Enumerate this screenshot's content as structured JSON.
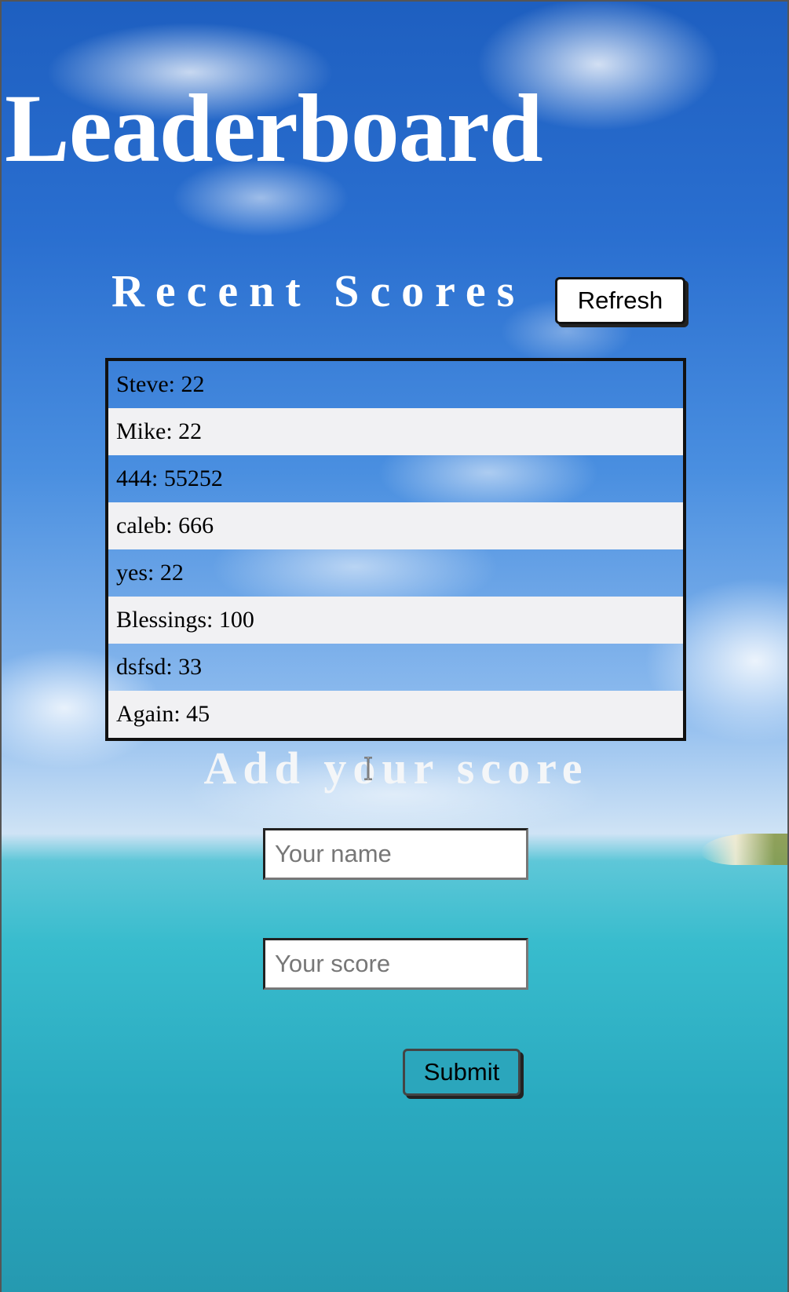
{
  "page": {
    "title": "Leaderboard",
    "background": "sky-and-ocean-photo",
    "colors": {
      "heading_text": "#ffffff",
      "row_alt_bg": "#f1f1f3",
      "list_border": "#111111"
    }
  },
  "recent_scores": {
    "heading": "Recent Scores",
    "refresh_label": "Refresh",
    "items": [
      {
        "label": "Steve: 22"
      },
      {
        "label": "Mike: 22"
      },
      {
        "label": "444: 55252"
      },
      {
        "label": "caleb: 666"
      },
      {
        "label": "yes: 22"
      },
      {
        "label": "Blessings: 100"
      },
      {
        "label": "dsfsd: 33"
      },
      {
        "label": "Again: 45"
      }
    ]
  },
  "add_score": {
    "heading": "Add your score",
    "name_placeholder": "Your name",
    "score_placeholder": "Your score",
    "submit_label": "Submit"
  },
  "cursor": {
    "icon": "text-cursor-icon"
  }
}
